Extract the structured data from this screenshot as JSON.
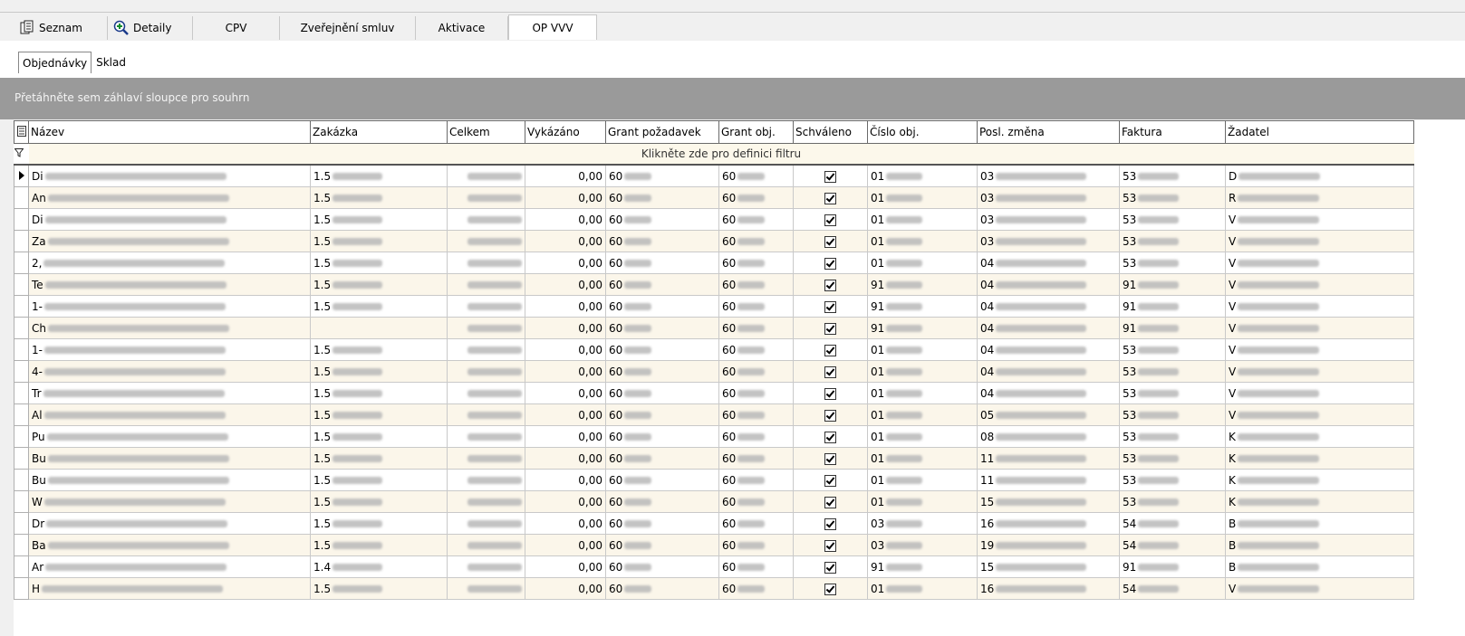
{
  "tabs": [
    {
      "label": "Seznam",
      "icon": "list-view-icon"
    },
    {
      "label": "Detaily",
      "icon": "zoom-in-icon"
    },
    {
      "label": "CPV",
      "icon": ""
    },
    {
      "label": "Zveřejnění smluv",
      "icon": ""
    },
    {
      "label": "Aktivace",
      "icon": ""
    },
    {
      "label": "OP VVV",
      "icon": ""
    }
  ],
  "subtabs": [
    "Objednávky",
    "Sklad"
  ],
  "group_hint": "Přetáhněte sem záhlaví sloupce pro souhrn",
  "filter_hint": "Klikněte zde pro definici filtru",
  "columns": [
    "Název",
    "Zakázka",
    "Celkem",
    "Vykázáno",
    "Grant požadavek",
    "Grant obj.",
    "Schváleno",
    "Číslo obj.",
    "Posl. změna",
    "Faktura",
    "Žadatel"
  ],
  "rows": [
    {
      "nazev": "Di",
      "zakazka": "1.5",
      "vykazano": "0,00",
      "grant_poz": "60",
      "grant_obj": "60",
      "cislo": "01",
      "zmena": "03",
      "faktura": "53",
      "zadatel": "D"
    },
    {
      "nazev": "An",
      "zakazka": "1.5",
      "vykazano": "0,00",
      "grant_poz": "60",
      "grant_obj": "60",
      "cislo": "01",
      "zmena": "03",
      "faktura": "53",
      "zadatel": "R"
    },
    {
      "nazev": "Di",
      "zakazka": "1.5",
      "vykazano": "0,00",
      "grant_poz": "60",
      "grant_obj": "60",
      "cislo": "01",
      "zmena": "03",
      "faktura": "53",
      "zadatel": "V"
    },
    {
      "nazev": "Za",
      "zakazka": "1.5",
      "vykazano": "0,00",
      "grant_poz": "60",
      "grant_obj": "60",
      "cislo": "01",
      "zmena": "03",
      "faktura": "53",
      "zadatel": "V"
    },
    {
      "nazev": "2,",
      "zakazka": "1.5",
      "vykazano": "0,00",
      "grant_poz": "60",
      "grant_obj": "60",
      "cislo": "01",
      "zmena": "04",
      "faktura": "53",
      "zadatel": "V"
    },
    {
      "nazev": "Te",
      "zakazka": "1.5",
      "vykazano": "0,00",
      "grant_poz": "60",
      "grant_obj": "60",
      "cislo": "91",
      "zmena": "04",
      "faktura": "91",
      "zadatel": "V"
    },
    {
      "nazev": "1-",
      "zakazka": "1.5",
      "vykazano": "0,00",
      "grant_poz": "60",
      "grant_obj": "60",
      "cislo": "91",
      "zmena": "04",
      "faktura": "91",
      "zadatel": "V"
    },
    {
      "nazev": "Ch",
      "zakazka": "",
      "vykazano": "0,00",
      "grant_poz": "60",
      "grant_obj": "60",
      "cislo": "91",
      "zmena": "04",
      "faktura": "91",
      "zadatel": "V"
    },
    {
      "nazev": "1-",
      "zakazka": "1.5",
      "vykazano": "0,00",
      "grant_poz": "60",
      "grant_obj": "60",
      "cislo": "01",
      "zmena": "04",
      "faktura": "53",
      "zadatel": "V"
    },
    {
      "nazev": "4-",
      "zakazka": "1.5",
      "vykazano": "0,00",
      "grant_poz": "60",
      "grant_obj": "60",
      "cislo": "01",
      "zmena": "04",
      "faktura": "53",
      "zadatel": "V"
    },
    {
      "nazev": "Tr",
      "zakazka": "1.5",
      "vykazano": "0,00",
      "grant_poz": "60",
      "grant_obj": "60",
      "cislo": "01",
      "zmena": "04",
      "faktura": "53",
      "zadatel": "V"
    },
    {
      "nazev": "Al",
      "zakazka": "1.5",
      "vykazano": "0,00",
      "grant_poz": "60",
      "grant_obj": "60",
      "cislo": "01",
      "zmena": "05",
      "faktura": "53",
      "zadatel": "V"
    },
    {
      "nazev": "Pu",
      "zakazka": "1.5",
      "vykazano": "0,00",
      "grant_poz": "60",
      "grant_obj": "60",
      "cislo": "01",
      "zmena": "08",
      "faktura": "53",
      "zadatel": "K"
    },
    {
      "nazev": "Bu",
      "zakazka": "1.5",
      "vykazano": "0,00",
      "grant_poz": "60",
      "grant_obj": "60",
      "cislo": "01",
      "zmena": "11",
      "faktura": "53",
      "zadatel": "K"
    },
    {
      "nazev": "Bu",
      "zakazka": "1.5",
      "vykazano": "0,00",
      "grant_poz": "60",
      "grant_obj": "60",
      "cislo": "01",
      "zmena": "11",
      "faktura": "53",
      "zadatel": "K"
    },
    {
      "nazev": "W",
      "zakazka": "1.5",
      "vykazano": "0,00",
      "grant_poz": "60",
      "grant_obj": "60",
      "cislo": "01",
      "zmena": "15",
      "faktura": "53",
      "zadatel": "K"
    },
    {
      "nazev": "Dr",
      "zakazka": "1.5",
      "vykazano": "0,00",
      "grant_poz": "60",
      "grant_obj": "60",
      "cislo": "03",
      "zmena": "16",
      "faktura": "54",
      "zadatel": "B"
    },
    {
      "nazev": "Ba",
      "zakazka": "1.5",
      "vykazano": "0,00",
      "grant_poz": "60",
      "grant_obj": "60",
      "cislo": "03",
      "zmena": "19",
      "faktura": "54",
      "zadatel": "B"
    },
    {
      "nazev": "Ar",
      "zakazka": "1.4",
      "vykazano": "0,00",
      "grant_poz": "60",
      "grant_obj": "60",
      "cislo": "91",
      "zmena": "15",
      "faktura": "91",
      "zadatel": "B"
    },
    {
      "nazev": "H",
      "zakazka": "1.5",
      "vykazano": "0,00",
      "grant_poz": "60",
      "grant_obj": "60",
      "cislo": "01",
      "zmena": "16",
      "faktura": "54",
      "zadatel": "V"
    }
  ]
}
